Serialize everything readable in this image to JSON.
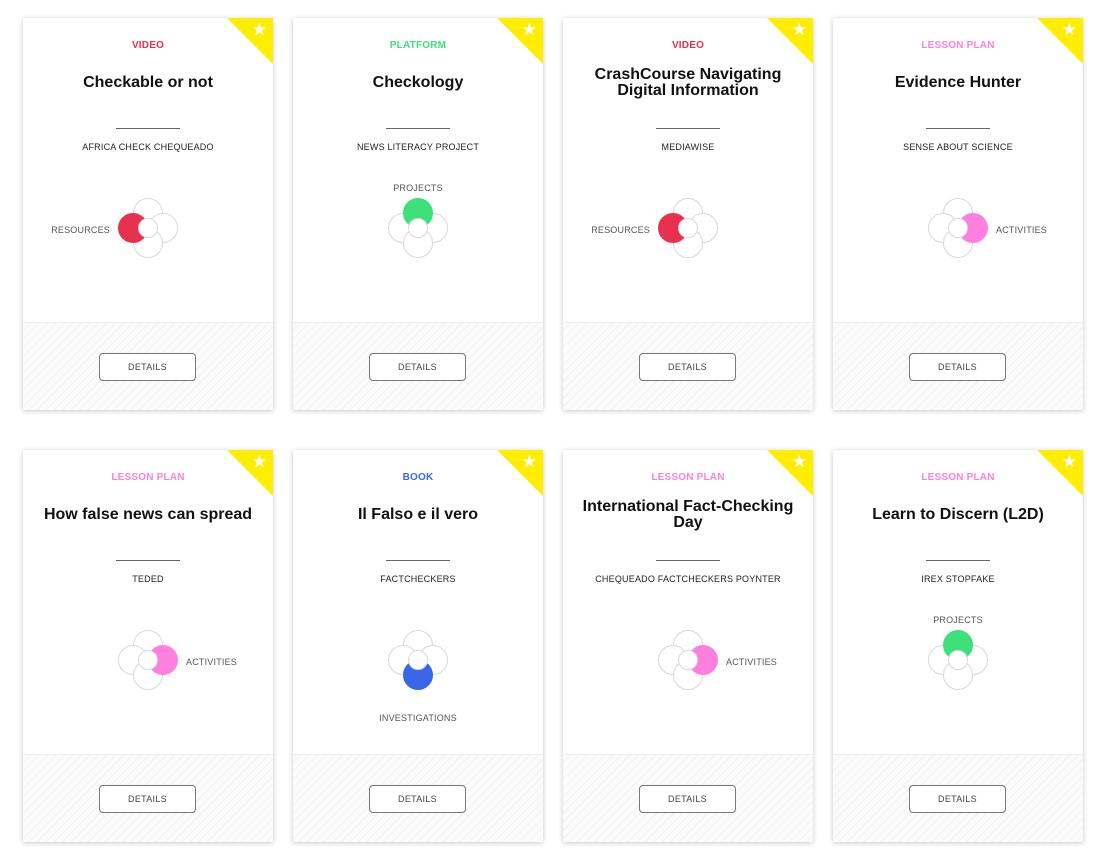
{
  "colors": {
    "video": "#e8304f",
    "platform": "#3ee07a",
    "lesson_plan": "#ff7fdf",
    "book": "#3a66e8",
    "ribbon": "#ffee00"
  },
  "cards": [
    {
      "type": "VIDEO",
      "type_color": "#e8304f",
      "title": "Checkable or not",
      "org": "AFRICA CHECK CHEQUEADO",
      "category": "RESOURCES",
      "category_position": "left",
      "category_color": "#e8304f",
      "button": "DETAILS",
      "icon": "star-icon"
    },
    {
      "type": "PLATFORM",
      "type_color": "#3ee07a",
      "title": "Checkology",
      "org": "NEWS LITERACY PROJECT",
      "category": "PROJECTS",
      "category_position": "top",
      "category_color": "#3ee07a",
      "button": "DETAILS",
      "icon": "star-icon"
    },
    {
      "type": "VIDEO",
      "type_color": "#e8304f",
      "title": "CrashCourse Navigating Digital Information",
      "org": "MEDIAWISE",
      "category": "RESOURCES",
      "category_position": "left",
      "category_color": "#e8304f",
      "button": "DETAILS",
      "icon": "star-icon"
    },
    {
      "type": "LESSON PLAN",
      "type_color": "#ff7fdf",
      "title": "Evidence Hunter",
      "org": "SENSE ABOUT SCIENCE",
      "category": "ACTIVITIES",
      "category_position": "right",
      "category_color": "#ff7fdf",
      "button": "DETAILS",
      "icon": "star-icon"
    },
    {
      "type": "LESSON PLAN",
      "type_color": "#ff7fdf",
      "title": "How false news can spread",
      "org": "TEDED",
      "category": "ACTIVITIES",
      "category_position": "right",
      "category_color": "#ff7fdf",
      "button": "DETAILS",
      "icon": "star-icon"
    },
    {
      "type": "BOOK",
      "type_color": "#3a66e8",
      "title": "Il Falso e il vero",
      "org": "FACTCHECKERS",
      "category": "INVESTIGATIONS",
      "category_position": "bottom",
      "category_color": "#3a66e8",
      "button": "DETAILS",
      "icon": "star-icon"
    },
    {
      "type": "LESSON PLAN",
      "type_color": "#ff7fdf",
      "title": "International Fact-Checking Day",
      "org": "CHEQUEADO FACTCHECKERS POYNTER",
      "category": "ACTIVITIES",
      "category_position": "right",
      "category_color": "#ff7fdf",
      "button": "DETAILS",
      "icon": "star-icon"
    },
    {
      "type": "LESSON PLAN",
      "type_color": "#ff7fdf",
      "title": "Learn to Discern (L2D)",
      "org": "IREX STOPFAKE",
      "category": "PROJECTS",
      "category_position": "top",
      "category_color": "#3ee07a",
      "button": "DETAILS",
      "icon": "star-icon"
    }
  ]
}
